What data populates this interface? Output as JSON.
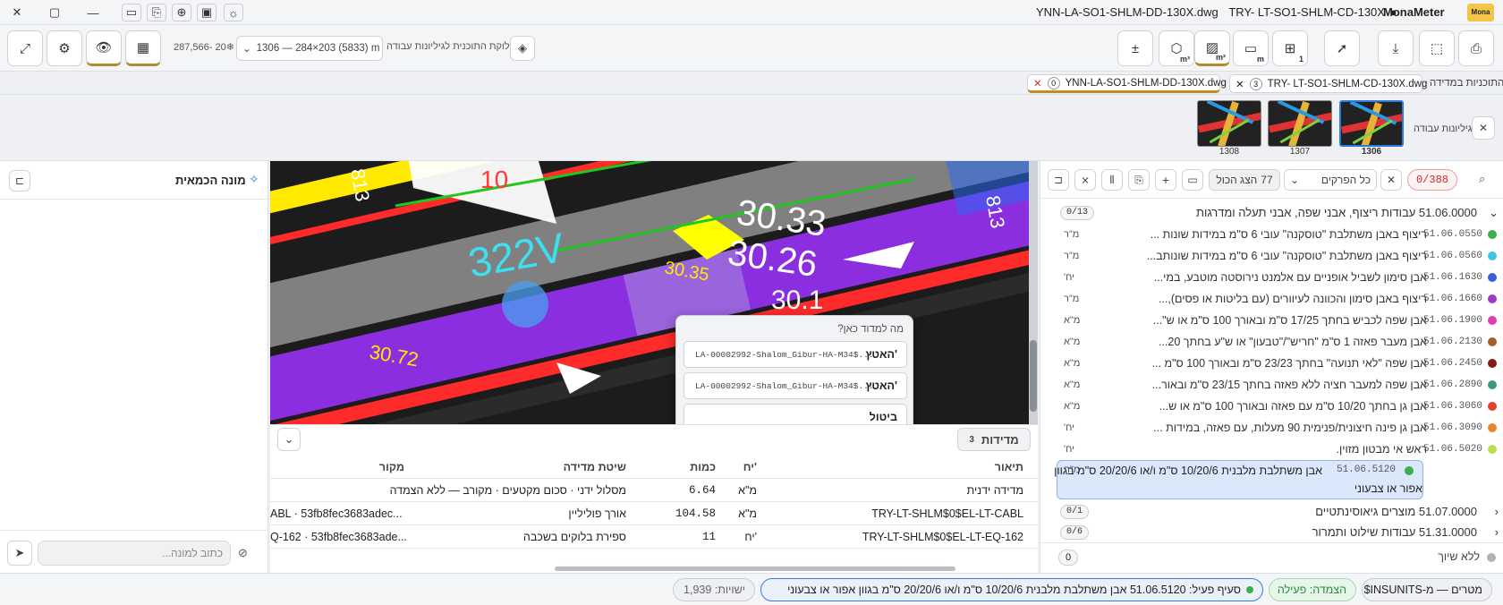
{
  "window": {
    "app_name": "MonaMeter",
    "title_file1": "YNN-LA-SO1-SHLM-DD-130X.dwg",
    "title_file2": "TRY- LT-SO1-SHLM-CD-130X",
    "title_dot": "●",
    "logo_text": "Mona"
  },
  "toolbar": {
    "sheet_label": "חלוקת התוכנית לגיליונות עבודה",
    "sheet_value": "1306 — 284×203 (5833) m",
    "coords": "287,566-  20❄",
    "area_unit": "m²",
    "volume_unit": "m³",
    "length_unit": "m",
    "count_label": "1",
    "plusminus": "±"
  },
  "file_tabs": {
    "section_label": "התוכניות במדידה",
    "tabs": [
      {
        "name": "TRY- LT-SO1-SHLM-CD-130X.dwg",
        "count": "3"
      },
      {
        "name": "YNN-LA-SO1-SHLM-DD-130X.dwg",
        "count": "0"
      }
    ]
  },
  "sheets": {
    "label": "גיליונות עבודה",
    "items": [
      "1306",
      "1307",
      "1308"
    ]
  },
  "left_panel": {
    "title": "מונה הכמאית",
    "chat_placeholder": "כתוב למונה..."
  },
  "right_panel": {
    "counter": "0/388",
    "filter": "כל הפרקים",
    "show_all": "הצג הכול",
    "show_all_count": "77",
    "groups": [
      {
        "code": "51.06.0000",
        "title": "עבודות ריצוף, אבני שפה, אבני תעלה ומדרגות",
        "badge": "0/13"
      },
      {
        "code": "51.07.0000",
        "title": "מוצרים גיאוסינתטיים",
        "badge": "0/1"
      },
      {
        "code": "51.31.0000",
        "title": "עבודות שילוט ותמרור",
        "badge": "0/6"
      }
    ],
    "items": [
      {
        "code": "51.06.0550",
        "text": "ריצוף באבן משתלבת \"טוסקנה\" עובי 6 ס\"מ במידות שונות ...",
        "unit": "מ\"ר",
        "color": "#3cae4a"
      },
      {
        "code": "51.06.0560",
        "text": "ריצוף באבן משתלבת \"טוסקנה\" עובי 6 ס\"מ במידות שונותב...",
        "unit": "מ\"ר",
        "color": "#3bc6e0"
      },
      {
        "code": "51.06.1630",
        "text": "אבן סימון לשביל אופניים עם אלמנט נירוסטה מוטבע, במי...",
        "unit": "יח'",
        "color": "#3a5fd8"
      },
      {
        "code": "51.06.1660",
        "text": "ריצוף באבן סימון והכוונה לעיוורים (עם בליטות או פסים),...",
        "unit": "מ\"ר",
        "color": "#9b3cc8"
      },
      {
        "code": "51.06.1900",
        "text": "אבן שפה לכביש בחתך 17/25 ס\"מ ובאורך 100 ס\"מ או ש\"...",
        "unit": "מ\"א",
        "color": "#e03cb6"
      },
      {
        "code": "51.06.2130",
        "text": "אבן מעבר פאזה 1 ס\"מ \"חריש\"/\"טבעון\" או ש\"ע בחתך 20...",
        "unit": "מ\"א",
        "color": "#a0622a"
      },
      {
        "code": "51.06.2450",
        "text": "אבן שפה \"לאי תנועה\" בחתך 23/23 ס\"מ ובאורך 100 ס\"מ ...",
        "unit": "מ\"א",
        "color": "#8a1a1a"
      },
      {
        "code": "51.06.2890",
        "text": "אבן שפה למעבר חציה ללא פאזה בחתך 23/15 ס\"מ ובאור...",
        "unit": "מ\"א",
        "color": "#3a9a7a"
      },
      {
        "code": "51.06.3060",
        "text": "אבן גן בחתך 10/20 ס\"מ עם פאזה ובאורך 100 ס\"מ או ש...",
        "unit": "מ\"א",
        "color": "#e0432a"
      },
      {
        "code": "51.06.3090",
        "text": "אבן גן פינה חיצונית/פנימית 90 מעלות, עם פאזה, במידות ...",
        "unit": "יח'",
        "color": "#e8842a"
      },
      {
        "code": "51.06.5020",
        "text": "ראש אי מבטון מזוין.",
        "unit": "יח'",
        "color": "#b8e04a"
      }
    ],
    "selected": {
      "code": "51.06.5120",
      "line1": "אבן משתלבת מלבנית 10/20/6 ס\"מ ו/או 20/20/6 ס\"מ בגוון",
      "line2": "אפור או צבעוני",
      "unit": "מ\"ר",
      "color": "#3cae4a"
    },
    "unassigned": {
      "label": "ללא שיוך",
      "count": "0"
    }
  },
  "canvas_labels": {
    "a": "30.33",
    "b": "30.26",
    "c": "322V",
    "d": "30.35",
    "e": "30.72",
    "f": "10",
    "g": "813",
    "h": "30.1"
  },
  "popup": {
    "title": "מה למדוד כאן?",
    "option1_label": "האטץ'",
    "option1_value": "LA-00002992-Shalom_Gibur-HA-M34$...",
    "option2_label": "האטץ'",
    "option2_value": "LA-00002992-Shalom_Gibur-HA-M34$...",
    "cancel": "ביטול"
  },
  "measurements": {
    "title": "מדידות",
    "count": "3",
    "headers": {
      "desc": "תיאור",
      "unit": "יח'",
      "qty": "כמות",
      "method": "שיטת מדידה",
      "source": "מקור"
    },
    "rows": [
      {
        "desc": "מדידה ידנית",
        "unit": "מ\"א",
        "qty": "6.64",
        "method": "מסלול ידני · סכום מקטעים · מקורב — ללא הצמדה",
        "source": ""
      },
      {
        "desc": "TRY-LT-SHLM$0$EL-LT-CABL",
        "unit": "מ\"א",
        "qty": "104.58",
        "method": "אורך פוליליין",
        "source": "ABL · 53fb8fec3683adec..."
      },
      {
        "desc": "TRY-LT-SHLM$0$EL-LT-EQ-162",
        "unit": "יח'",
        "qty": "11",
        "method": "ספירת בלוקים בשכבה",
        "source": "Q-162 · 53fb8fec3683ade..."
      }
    ]
  },
  "statusbar": {
    "units": "מטרים — מ-INSUNITS$",
    "snap": "הצמדה: פעילה",
    "active_item": "סעיף פעיל: 51.06.5120 אבן משתלבת מלבנית 10/20/6 ס\"מ ו/או 20/20/6 ס\"מ בגוון אפור או צבעוני",
    "entities": "ישויות: 1,939"
  }
}
